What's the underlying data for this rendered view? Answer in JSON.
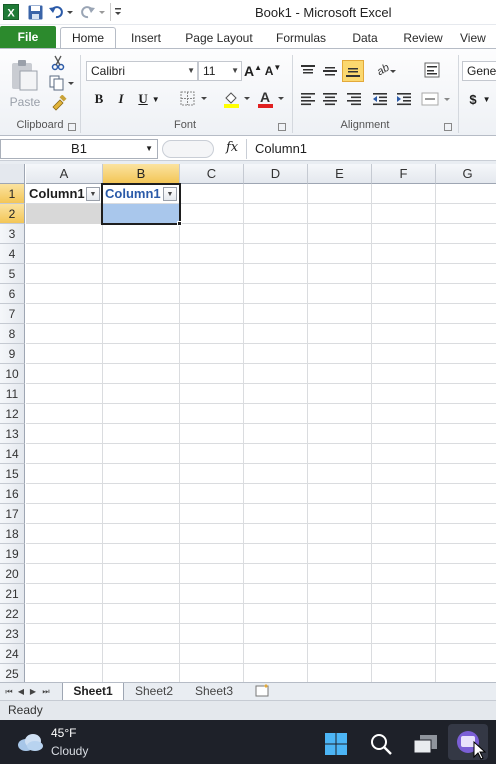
{
  "window": {
    "title": "Book1  -  Microsoft Excel"
  },
  "tabs": {
    "file": "File",
    "home": "Home",
    "insert": "Insert",
    "page_layout": "Page Layout",
    "formulas": "Formulas",
    "data": "Data",
    "review": "Review",
    "view": "View"
  },
  "ribbon": {
    "clipboard": {
      "label": "Clipboard",
      "paste": "Paste"
    },
    "font": {
      "label": "Font",
      "name": "Calibri",
      "size": "11",
      "bold": "B",
      "italic": "I",
      "underline": "U",
      "grow": "A",
      "shrink": "A"
    },
    "alignment": {
      "label": "Alignment"
    },
    "number": {
      "format": "Gener",
      "currency": "$"
    }
  },
  "formula_bar": {
    "name_box": "B1",
    "fx": "fx",
    "content": "Column1"
  },
  "columns": [
    "A",
    "B",
    "C",
    "D",
    "E",
    "F",
    "G"
  ],
  "rows": [
    "1",
    "2",
    "3",
    "4",
    "5",
    "6",
    "7",
    "8",
    "9",
    "10",
    "11",
    "12",
    "13",
    "14",
    "15",
    "16",
    "17",
    "18",
    "19",
    "20",
    "21",
    "22",
    "23",
    "24",
    "25"
  ],
  "cells": {
    "A1": "Column1",
    "B1": "Column1"
  },
  "sheets": [
    "Sheet1",
    "Sheet2",
    "Sheet3"
  ],
  "status": {
    "text": "Ready"
  },
  "taskbar": {
    "temp": "45°F",
    "condition": "Cloudy"
  },
  "colors": {
    "file_tab": "#2c8a2d",
    "selected_header": "#f3c657",
    "selected_cell": "#a9c7ec",
    "taskbar": "#1e2129"
  }
}
